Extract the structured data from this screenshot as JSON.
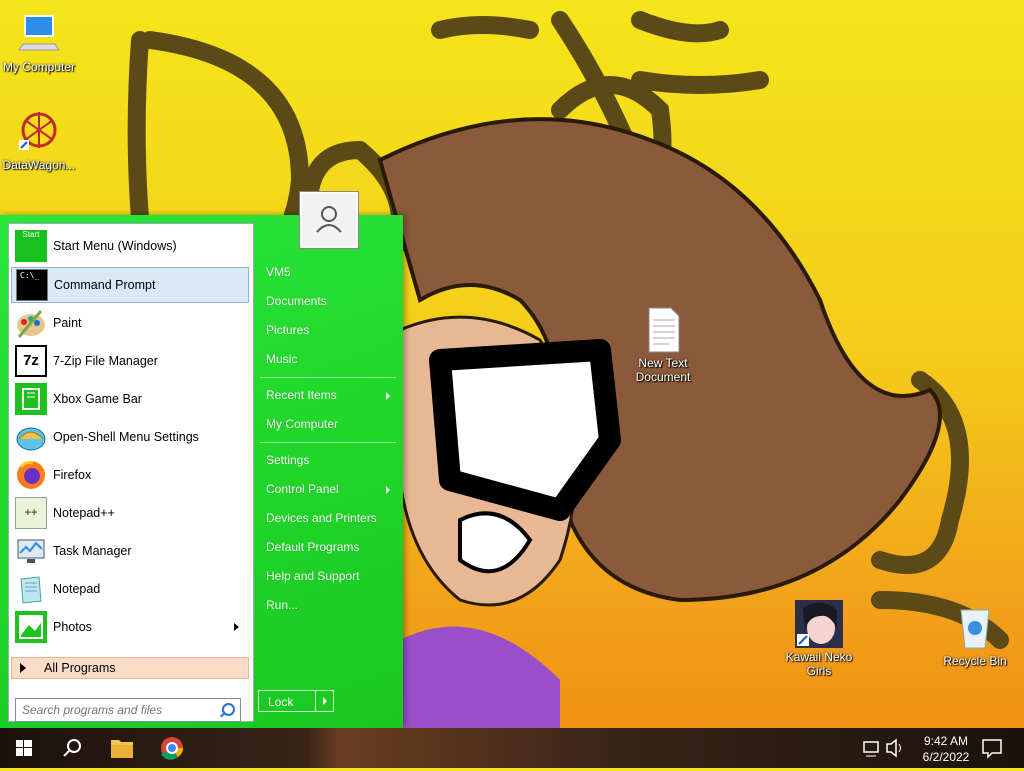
{
  "desktop": {
    "icons": [
      {
        "label": "My Computer",
        "icon": "computer-icon"
      },
      {
        "label": "DataWagon...",
        "icon": "datawagon-icon"
      },
      {
        "label": "New Text Document",
        "icon": "text-document-icon"
      },
      {
        "label": "Kawaii Neko Girls",
        "icon": "kawaii-neko-girls-icon"
      },
      {
        "label": "Recycle Bin",
        "icon": "recycle-bin-icon"
      }
    ]
  },
  "start_menu": {
    "programs": [
      {
        "label": "Start Menu (Windows)",
        "icon": "start-menu-icon"
      },
      {
        "label": "Command Prompt",
        "icon": "command-prompt-icon"
      },
      {
        "label": "Paint",
        "icon": "paint-icon"
      },
      {
        "label": "7-Zip File Manager",
        "icon": "7zip-icon"
      },
      {
        "label": "Xbox Game Bar",
        "icon": "xbox-game-bar-icon"
      },
      {
        "label": "Open-Shell Menu Settings",
        "icon": "open-shell-icon"
      },
      {
        "label": "Firefox",
        "icon": "firefox-icon"
      },
      {
        "label": "Notepad++",
        "icon": "notepad-plus-plus-icon"
      },
      {
        "label": "Task Manager",
        "icon": "task-manager-icon"
      },
      {
        "label": "Notepad",
        "icon": "notepad-icon"
      },
      {
        "label": "Photos",
        "icon": "photos-icon"
      }
    ],
    "start_icon_text": "Start",
    "cmd_icon_text": "C:\\_",
    "zip_icon_text": "7z",
    "npp_icon_text": "++",
    "all_programs": "All Programs",
    "search_placeholder": "Search programs and files",
    "right_items": [
      "VM5",
      "Documents",
      "Pictures",
      "Music",
      "Recent Items",
      "My Computer",
      "Settings",
      "Control Panel",
      "Devices and Printers",
      "Default Programs",
      "Help and Support",
      "Run..."
    ],
    "lock_label": "Lock"
  },
  "taskbar": {
    "time": "9:42 AM",
    "date": "6/2/2022"
  },
  "colors": {
    "start_menu_bg": "#23d92c",
    "highlight": "#dae8f8",
    "all_programs_bg": "#fbdcc6"
  }
}
